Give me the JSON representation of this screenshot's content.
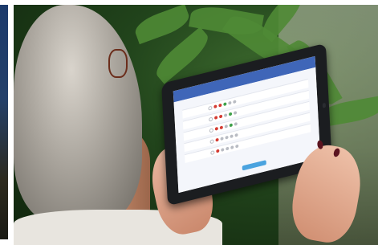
{
  "scene": {
    "description_elements": [
      "background-plant",
      "person",
      "tablet"
    ]
  },
  "tablet": {
    "app_title": "",
    "rows": [
      {
        "label": "",
        "dots": [
          "white",
          "red",
          "red",
          "green",
          "gray",
          "gray"
        ]
      },
      {
        "label": "",
        "dots": [
          "white",
          "red",
          "red",
          "gray",
          "green",
          "gray"
        ]
      },
      {
        "label": "",
        "dots": [
          "white",
          "red",
          "red",
          "gray",
          "green",
          "gray"
        ]
      },
      {
        "label": "",
        "dots": [
          "white",
          "red",
          "gray",
          "gray",
          "gray",
          "gray"
        ]
      },
      {
        "label": "",
        "dots": [
          "white",
          "red",
          "gray",
          "gray",
          "gray",
          "gray"
        ]
      }
    ],
    "submit_label": ""
  }
}
